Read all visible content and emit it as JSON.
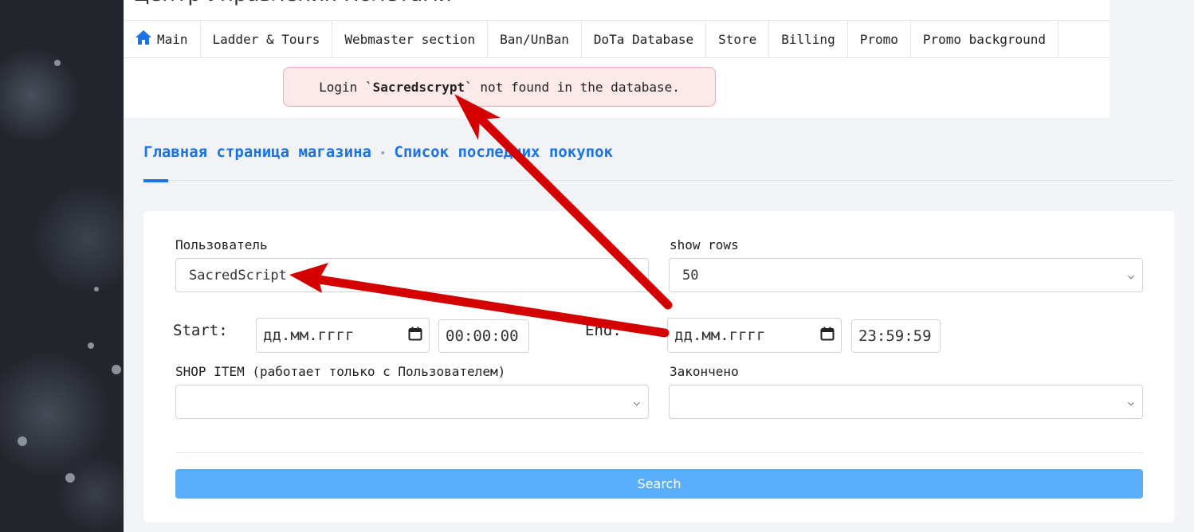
{
  "page": {
    "title": "Центр Управления Полетами"
  },
  "nav": {
    "items": [
      {
        "label": "Main",
        "icon": "home-icon"
      },
      {
        "label": "Ladder & Tours"
      },
      {
        "label": "Webmaster section"
      },
      {
        "label": "Ban/UnBan"
      },
      {
        "label": "DoTa Database"
      },
      {
        "label": "Store"
      },
      {
        "label": "Billing"
      },
      {
        "label": "Promo"
      },
      {
        "label": "Promo background"
      }
    ]
  },
  "alert": {
    "prefix": "Login `",
    "login": "Sacredscrypt",
    "suffix": "` not found in the database."
  },
  "tabs": [
    {
      "label": "Главная страница магазина",
      "active": true
    },
    {
      "label": "Список последних покупок",
      "active": false
    }
  ],
  "tab_separator": "•",
  "form": {
    "user_label": "Пользователь",
    "user_value": "SacredScript",
    "rows_label": "show rows",
    "rows_value": "50",
    "start_label": "Start:",
    "start_date_placeholder": "дд.мм.гггг",
    "start_time": "00:00:00",
    "end_label": "End:",
    "end_date_placeholder": "дд.мм.гггг",
    "end_time": "23:59:59",
    "shop_item_label": "SHOP ITEM (работает только с Пользователем)",
    "shop_item_value": "",
    "finished_label": "Закончено",
    "finished_value": "",
    "search_label": "Search"
  },
  "colors": {
    "accent": "#1a73e8",
    "alert_bg": "#fde9ea",
    "alert_border": "#f2a8ad",
    "search_button": "#5aaefb",
    "annotation_arrow": "#d40000"
  }
}
